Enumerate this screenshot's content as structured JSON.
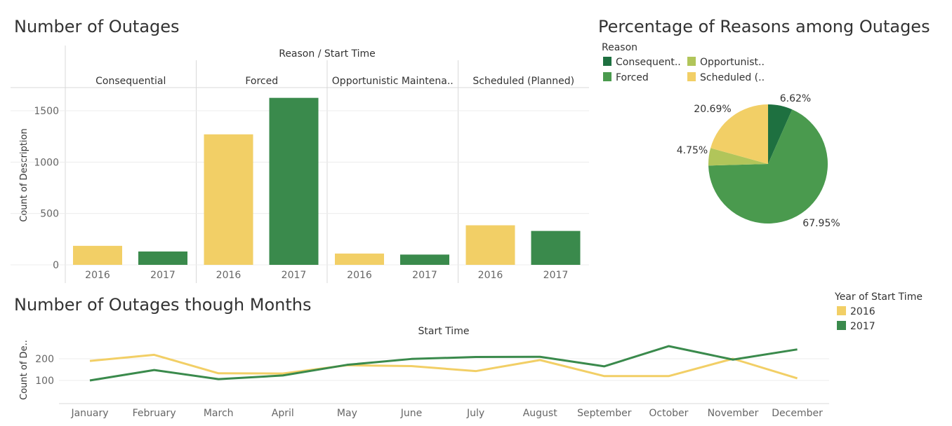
{
  "colors": {
    "y2016": "#F2CF66",
    "y2017": "#3A8A4C",
    "consequential": "#1E7040",
    "forced": "#4A9A4E",
    "opportunistic": "#B1C55A",
    "scheduled": "#F2CF66"
  },
  "legend_year": {
    "title": "Year of Start Time",
    "items": [
      {
        "label": "2016",
        "color": "#F2CF66"
      },
      {
        "label": "2017",
        "color": "#3A8A4C"
      }
    ]
  },
  "chart_data": [
    {
      "type": "bar",
      "title": "Number of Outages",
      "column_header": "Reason  /  Start Time",
      "ylabel": "Count of Description",
      "ylim": [
        0,
        1700
      ],
      "yticks": [
        "0",
        "500",
        "1000",
        "1500"
      ],
      "groups": [
        {
          "label": "Consequential",
          "bars": [
            {
              "x": "2016",
              "value": 185
            },
            {
              "x": "2017",
              "value": 130
            }
          ]
        },
        {
          "label": "Forced",
          "bars": [
            {
              "x": "2016",
              "value": 1270
            },
            {
              "x": "2017",
              "value": 1625
            }
          ]
        },
        {
          "label": "Opportunistic Maintena..",
          "bars": [
            {
              "x": "2016",
              "value": 110
            },
            {
              "x": "2017",
              "value": 100
            }
          ]
        },
        {
          "label": "Scheduled (Planned)",
          "bars": [
            {
              "x": "2016",
              "value": 385
            },
            {
              "x": "2017",
              "value": 330
            }
          ]
        }
      ]
    },
    {
      "type": "pie",
      "title": "Percentage of Reasons among Outages",
      "legend_title": "Reason",
      "legend": [
        "Consequent..",
        "Opportunist..",
        "Forced",
        "Scheduled (.."
      ],
      "slices": [
        {
          "name": "Consequential",
          "value": 6.62,
          "label": "6.62%"
        },
        {
          "name": "Forced",
          "value": 67.95,
          "label": "67.95%"
        },
        {
          "name": "Opportunistic Maintenance",
          "value": 4.75,
          "label": "4.75%"
        },
        {
          "name": "Scheduled (Planned)",
          "value": 20.69,
          "label": "20.69%"
        }
      ]
    },
    {
      "type": "line",
      "title": "Number of Outages though Months",
      "column_header": "Start Time",
      "ylabel": "Count of De..",
      "ylim": [
        30,
        270
      ],
      "yticks": [
        "100",
        "200"
      ],
      "x": [
        "January",
        "February",
        "March",
        "April",
        "May",
        "June",
        "July",
        "August",
        "September",
        "October",
        "November",
        "December"
      ],
      "series": [
        {
          "name": "2016",
          "values": [
            190,
            218,
            133,
            132,
            170,
            166,
            143,
            194,
            120,
            120,
            200,
            110
          ]
        },
        {
          "name": "2017",
          "values": [
            100,
            148,
            106,
            123,
            172,
            199,
            208,
            209,
            165,
            258,
            196,
            243
          ]
        }
      ]
    }
  ]
}
